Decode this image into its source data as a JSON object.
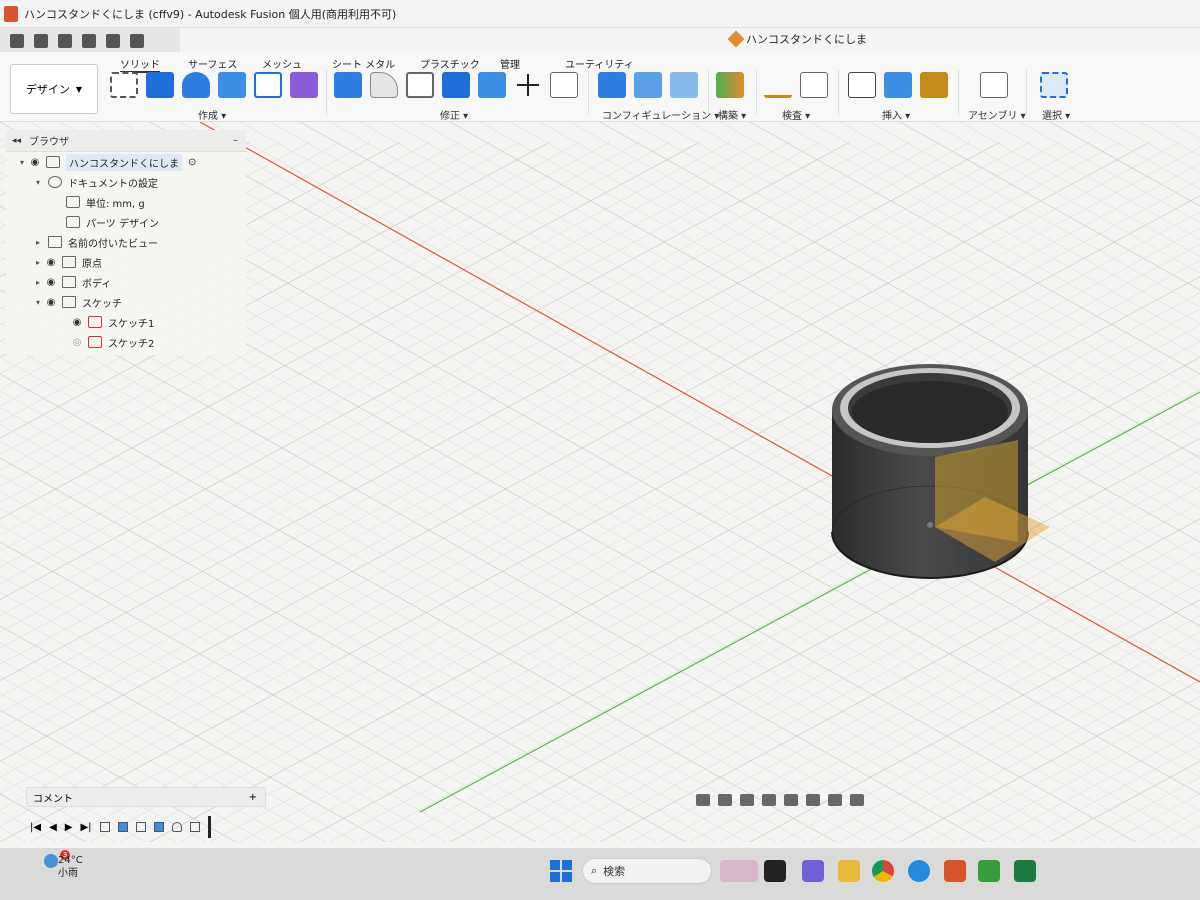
{
  "window": {
    "title": "ハンコスタンドくにしま (cffv9) - Autodesk Fusion 個人用(商用利用不可)",
    "doc_tab": "ハンコスタンドくにしま"
  },
  "ribbon": {
    "workspace": "デザイン",
    "tabs": [
      "ソリッド",
      "サーフェス",
      "メッシュ",
      "シート メタル",
      "プラスチック",
      "管理",
      "ユーティリティ"
    ],
    "groups": [
      "作成",
      "修正",
      "コンフィギュレーション",
      "構築",
      "検査",
      "挿入",
      "アセンブリ",
      "選択"
    ]
  },
  "browser": {
    "title": "ブラウザ",
    "items": [
      {
        "label": "ハンコスタンドくにしま"
      },
      {
        "label": "ドキュメントの設定"
      },
      {
        "label": "単位: mm, g"
      },
      {
        "label": "パーツ デザイン"
      },
      {
        "label": "名前の付いたビュー"
      },
      {
        "label": "原点"
      },
      {
        "label": "ボディ"
      },
      {
        "label": "スケッチ"
      },
      {
        "label": "スケッチ1"
      },
      {
        "label": "スケッチ2"
      }
    ]
  },
  "comment": {
    "label": "コメント",
    "add": "+"
  },
  "taskbar": {
    "temp": "24°C",
    "weather": "小雨",
    "badge": "3",
    "search_label": "検索"
  },
  "colors": {
    "accent": "#1e6fd9",
    "axis_red": "#d9573b",
    "axis_green": "#5ab84a",
    "model": "#3d3d3d"
  }
}
